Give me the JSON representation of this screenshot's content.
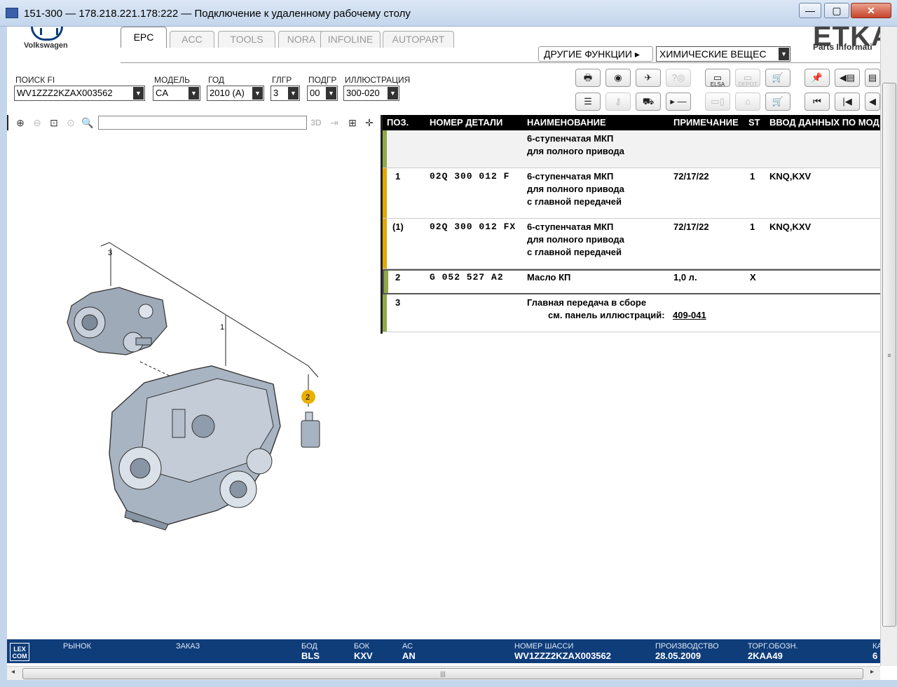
{
  "window": {
    "title": "151-300 — 178.218.221.178:222 — Подключение к удаленному рабочему столу",
    "min_icon": "minimize-icon",
    "max_icon": "maximize-icon",
    "close_icon": "close-icon",
    "min_glyph": "—",
    "max_glyph": "▢",
    "close_glyph": "✕"
  },
  "header": {
    "brand": "Volkswagen",
    "etka": "ETKA",
    "parts_info": "Parts Informati"
  },
  "tabs": [
    {
      "label": "EPC",
      "active": true
    },
    {
      "label": "ACC",
      "active": false
    },
    {
      "label": "TOOLS",
      "active": false
    },
    {
      "label": "NORA",
      "active": false
    },
    {
      "label": "INFOLINE",
      "active": false
    },
    {
      "label": "AUTOPART",
      "active": false
    }
  ],
  "other_functions": {
    "label": "ДРУГИЕ ФУНКЦИИ ▸",
    "selected": "ХИМИЧЕСКИЕ ВЕЩЕС"
  },
  "fields": {
    "search_fi": {
      "label": "ПОИСК FI",
      "value": "WV1ZZZ2KZAX003562"
    },
    "model": {
      "label": "МОДЕЛЬ",
      "value": "CA"
    },
    "year": {
      "label": "ГОД",
      "value": "2010 (A)"
    },
    "mg": {
      "label": "ГЛГР",
      "value": "3"
    },
    "sg": {
      "label": "ПОДГР",
      "value": "00"
    },
    "illustration": {
      "label": "ИЛЛЮСТРАЦИЯ",
      "value": "300-020"
    }
  },
  "toolbar_icons": {
    "print": "print-icon",
    "camera": "camera-icon",
    "service": "service-icon",
    "help": "help-icon",
    "elsa": "ELSA",
    "depot": "DEPOT",
    "cart_add": "cart-add-icon",
    "pin": "pin-icon",
    "nav_back": "nav-back-icon",
    "doc": "document-icon",
    "list": "list-icon",
    "key": "key-icon",
    "car": "car-icon",
    "play_minus": "▸ —",
    "pc": "pc-icon",
    "dealer": "dealer-icon",
    "cart": "cart-icon",
    "first": "first-page-icon",
    "prev": "previous-page-icon",
    "prev2": "previous-icon"
  },
  "zoom_tools": {
    "zoom_in": "zoom-in-icon",
    "zoom_out": "zoom-out-icon",
    "zoom_fit": "zoom-fit-icon",
    "zoom_100": "zoom-100-icon",
    "search": "search-icon",
    "three_d": "3D",
    "mode": "image-mode-icon",
    "split": "split-view-icon",
    "move": "move-icon"
  },
  "parts_table": {
    "columns": [
      "ПОЗ.",
      "НОМЕР ДЕТАЛИ",
      "НАИМЕНОВАНИЕ",
      "ПРИМЕЧАНИЕ",
      "ST",
      "ВВОД ДАННЫХ ПО МОД"
    ],
    "rows": [
      {
        "pos": "",
        "part": "",
        "name": [
          "6-ступенчатая МКП",
          "для полного привода"
        ],
        "note": "",
        "st": "",
        "model": "",
        "color": "#8fa84a",
        "bg": "#f2f2f2"
      },
      {
        "pos": "1",
        "part": "02Q  300  012  F",
        "name": [
          "6-ступенчатая МКП",
          "для полного привода",
          "с главной передачей"
        ],
        "note": "72/17/22",
        "st": "1",
        "model": "KNQ,KXV",
        "color": "#e0a800",
        "bg": "#ffffff"
      },
      {
        "pos": "(1)",
        "part": "02Q  300  012  FX",
        "name": [
          "6-ступенчатая МКП",
          "для полного привода",
          "с главной передачей"
        ],
        "note": "72/17/22",
        "st": "1",
        "model": "KNQ,KXV",
        "color": "#e0a800",
        "bg": "#ffffff"
      },
      {
        "pos": "2",
        "part": "G    052  527  A2",
        "name": [
          "Масло КП"
        ],
        "note": "1,0 л.",
        "st": "X",
        "model": "",
        "color": "#8fa84a",
        "bg": "#ffffff"
      },
      {
        "pos": "3",
        "part": "",
        "name": [
          "Главная передача в сборе"
        ],
        "sub": "см. панель иллюстраций:",
        "link": "409-041",
        "note": "",
        "st": "",
        "model": "",
        "color": "#8fa84a",
        "bg": "#ffffff"
      }
    ]
  },
  "illustration": {
    "callouts": [
      "3",
      "1",
      "2"
    ]
  },
  "status": {
    "logo": "LEX COM",
    "market": {
      "label": "РЫНОК",
      "value": ""
    },
    "order": {
      "label": "ЗАКАЗ",
      "value": ""
    },
    "body": {
      "label": "БОД",
      "value": "BLS"
    },
    "gearbox": {
      "label": "БОК",
      "value": "KXV"
    },
    "ac": {
      "label": "АС",
      "value": "AN"
    },
    "chassis": {
      "label": "НОМЕР ШАССИ",
      "value": "WV1ZZZ2KZAX003562"
    },
    "production": {
      "label": "ПРОИЗВОДСТВО",
      "value": "28.05.2009"
    },
    "trade": {
      "label": "ТОРГ.ОБОЗН.",
      "value": "2KAA49"
    },
    "extra": {
      "label": "КА",
      "value": "6"
    }
  },
  "scroll": {
    "grip": "≡",
    "hgrip": "|||",
    "left": "◂",
    "right": "▸"
  }
}
